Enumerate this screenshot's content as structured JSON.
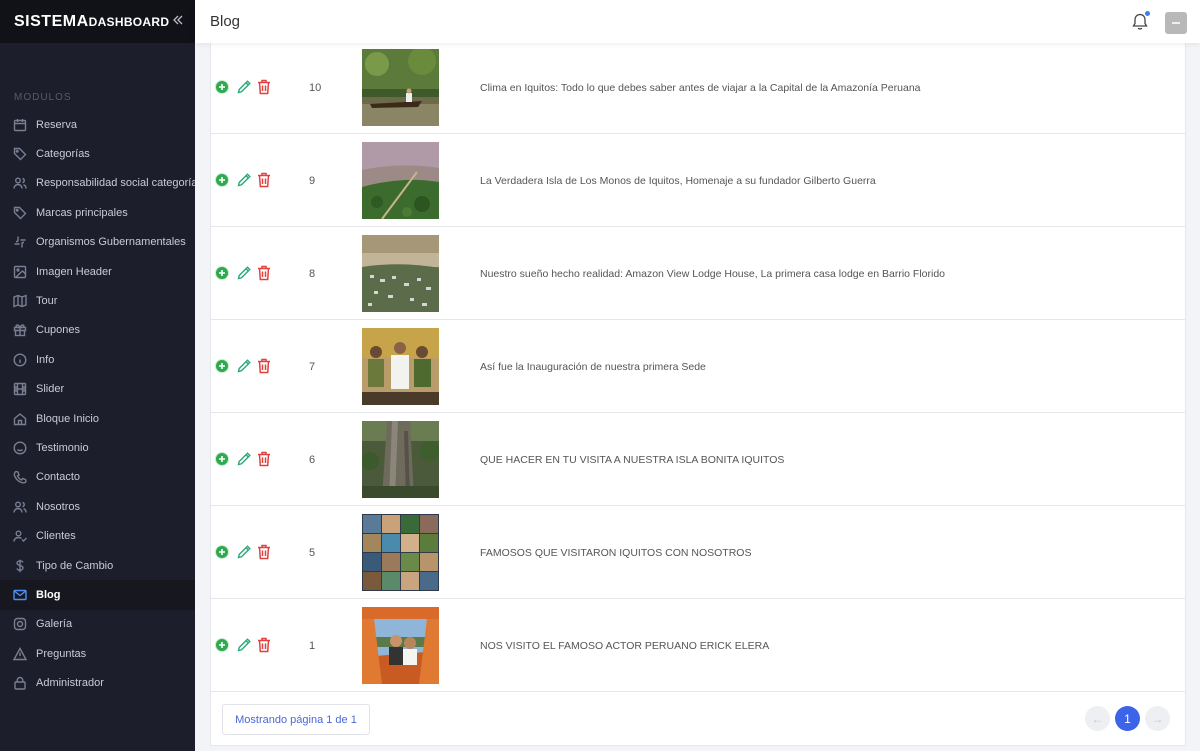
{
  "brand": {
    "part1": "SISTEMA",
    "part2": "DASHBOARD"
  },
  "sidebar": {
    "section_label": "MODULOS",
    "items": [
      {
        "label": "Reserva",
        "icon": "calendar-icon"
      },
      {
        "label": "Categorías",
        "icon": "tag-icon"
      },
      {
        "label": "Responsabilidad social categoría",
        "icon": "users-icon"
      },
      {
        "label": "Marcas principales",
        "icon": "tag-icon"
      },
      {
        "label": "Organismos Gubernamentales",
        "icon": "slack-icon"
      },
      {
        "label": "Imagen Header",
        "icon": "image-icon"
      },
      {
        "label": "Tour",
        "icon": "map-icon"
      },
      {
        "label": "Cupones",
        "icon": "gift-icon"
      },
      {
        "label": "Info",
        "icon": "info-icon"
      },
      {
        "label": "Slider",
        "icon": "film-icon"
      },
      {
        "label": "Bloque Inicio",
        "icon": "home-icon"
      },
      {
        "label": "Testimonio",
        "icon": "smile-icon"
      },
      {
        "label": "Contacto",
        "icon": "phone-icon"
      },
      {
        "label": "Nosotros",
        "icon": "users-icon"
      },
      {
        "label": "Clientes",
        "icon": "user-check-icon"
      },
      {
        "label": "Tipo de Cambio",
        "icon": "dollar-icon"
      },
      {
        "label": "Blog",
        "icon": "mail-icon",
        "active": true
      },
      {
        "label": "Galería",
        "icon": "instagram-icon"
      },
      {
        "label": "Preguntas",
        "icon": "alert-triangle-icon"
      },
      {
        "label": "Administrador",
        "icon": "lock-icon"
      }
    ]
  },
  "header": {
    "title": "Blog"
  },
  "blog_rows": [
    {
      "id": "10",
      "title": "Clima en Iquitos: Todo lo que debes saber antes de viajar a la Capital de la Amazonía Peruana",
      "thumb": "river-canoe"
    },
    {
      "id": "9",
      "title": "La Verdadera Isla de Los Monos de Iquitos, Homenaje a su fundador Gilberto Guerra",
      "thumb": "aerial-river"
    },
    {
      "id": "8",
      "title": "Nuestro sueño hecho realidad: Amazon View Lodge House, La primera casa lodge en Barrio Florido",
      "thumb": "aerial-town"
    },
    {
      "id": "7",
      "title": "Así fue la Inauguración de nuestra primera Sede",
      "thumb": "group-people"
    },
    {
      "id": "6",
      "title": "QUE HACER EN TU VISITA A NUESTRA ISLA BONITA IQUITOS",
      "thumb": "giant-tree"
    },
    {
      "id": "5",
      "title": "FAMOSOS QUE VISITARON IQUITOS CON NOSOTROS",
      "thumb": "collage"
    },
    {
      "id": "1",
      "title": "NOS VISITO EL FAMOSO ACTOR PERUANO ERICK ELERA",
      "thumb": "boat-selfie"
    }
  ],
  "pagination": {
    "info": "Mostrando página 1 de 1",
    "current": "1",
    "prev": "←",
    "next": "→"
  },
  "colors": {
    "sidebar_bg": "#1d1e2c",
    "accent": "#3d63e8",
    "add": "#2fa84f",
    "edit": "#2aa876",
    "delete": "#e0413e"
  }
}
